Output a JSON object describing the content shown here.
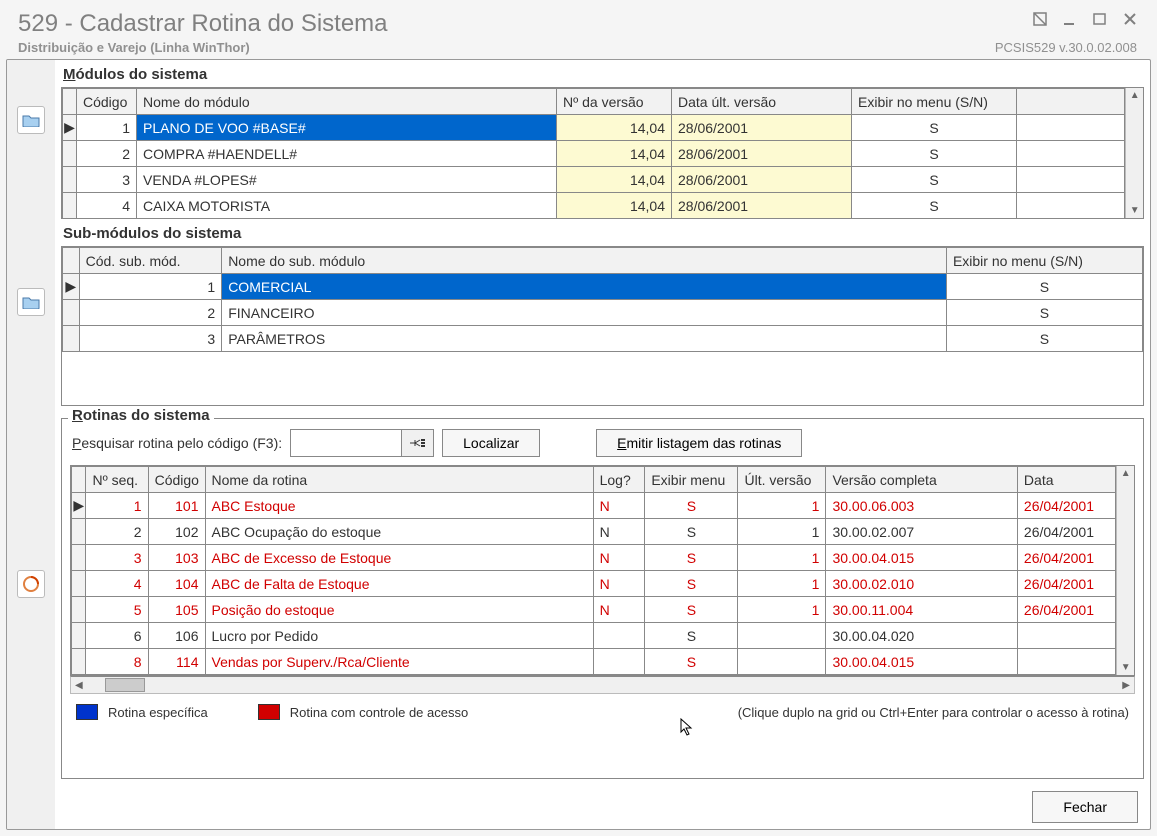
{
  "window": {
    "title": "529 - Cadastrar Rotina do Sistema",
    "subtitle": "Distribuição e Varejo (Linha WinThor)",
    "version": "PCSIS529  v.30.0.02.008"
  },
  "sections": {
    "modules_title": "Módulos do sistema",
    "submodules_title": "Sub-módulos do sistema",
    "routines_title": "Rotinas do sistema"
  },
  "modules": {
    "headers": {
      "codigo": "Código",
      "nome": "Nome do módulo",
      "versao": "Nº da versão",
      "data": "Data últ. versão",
      "exibir": "Exibir no menu (S/N)"
    },
    "rows": [
      {
        "codigo": "1",
        "nome": "PLANO DE VOO       #BASE#",
        "versao": "14,04",
        "data": "28/06/2001",
        "exibir": "S",
        "selected": true
      },
      {
        "codigo": "2",
        "nome": "COMPRA            #HAENDELL#",
        "versao": "14,04",
        "data": "28/06/2001",
        "exibir": "S"
      },
      {
        "codigo": "3",
        "nome": "VENDA              #LOPES#",
        "versao": "14,04",
        "data": "28/06/2001",
        "exibir": "S"
      },
      {
        "codigo": "4",
        "nome": "CAIXA MOTORISTA",
        "versao": "14,04",
        "data": "28/06/2001",
        "exibir": "S"
      }
    ]
  },
  "submodules": {
    "headers": {
      "codigo": "Cód. sub. mód.",
      "nome": "Nome do sub. módulo",
      "exibir": "Exibir no menu (S/N)"
    },
    "rows": [
      {
        "codigo": "1",
        "nome": "COMERCIAL",
        "exibir": "S",
        "selected": true
      },
      {
        "codigo": "2",
        "nome": "FINANCEIRO",
        "exibir": "S"
      },
      {
        "codigo": "3",
        "nome": "PARÂMETROS",
        "exibir": "S"
      }
    ]
  },
  "routines": {
    "search_label": "Pesquisar rotina pelo código (F3):",
    "btn_localizar": "Localizar",
    "btn_emitir": "Emitir listagem das rotinas",
    "headers": {
      "seq": "Nº seq.",
      "codigo": "Código",
      "nome": "Nome da rotina",
      "log": "Log?",
      "exibir": "Exibir menu",
      "ult": "Últ. versão",
      "ver": "Versão completa",
      "data": "Data"
    },
    "rows": [
      {
        "seq": "1",
        "codigo": "101",
        "nome": "ABC Estoque",
        "log": "N",
        "exibir": "S",
        "ult": "1",
        "ver": "30.00.06.003",
        "data": "26/04/2001",
        "red": true,
        "indicator": true
      },
      {
        "seq": "2",
        "codigo": "102",
        "nome": "ABC Ocupação do estoque",
        "log": "N",
        "exibir": "S",
        "ult": "1",
        "ver": "30.00.02.007",
        "data": "26/04/2001",
        "red": false
      },
      {
        "seq": "3",
        "codigo": "103",
        "nome": "ABC de Excesso de Estoque",
        "log": "N",
        "exibir": "S",
        "ult": "1",
        "ver": "30.00.04.015",
        "data": "26/04/2001",
        "red": true
      },
      {
        "seq": "4",
        "codigo": "104",
        "nome": "ABC de Falta de Estoque",
        "log": "N",
        "exibir": "S",
        "ult": "1",
        "ver": "30.00.02.010",
        "data": "26/04/2001",
        "red": true
      },
      {
        "seq": "5",
        "codigo": "105",
        "nome": "Posição do estoque",
        "log": "N",
        "exibir": "S",
        "ult": "1",
        "ver": "30.00.11.004",
        "data": "26/04/2001",
        "red": true
      },
      {
        "seq": "6",
        "codigo": "106",
        "nome": "Lucro por Pedido",
        "log": "",
        "exibir": "S",
        "ult": "",
        "ver": "30.00.04.020",
        "data": "",
        "red": false
      },
      {
        "seq": "8",
        "codigo": "114",
        "nome": "Vendas por Superv./Rca/Cliente",
        "log": "",
        "exibir": "S",
        "ult": "",
        "ver": "30.00.04.015",
        "data": "",
        "red": true
      }
    ]
  },
  "legend": {
    "especifica": "Rotina específica",
    "acesso": "Rotina com controle de acesso",
    "hint": "(Clique duplo na grid ou Ctrl+Enter para controlar o acesso à rotina)"
  },
  "buttons": {
    "fechar": "Fechar"
  },
  "colors": {
    "blue": "#0033cc",
    "red": "#d10000"
  }
}
